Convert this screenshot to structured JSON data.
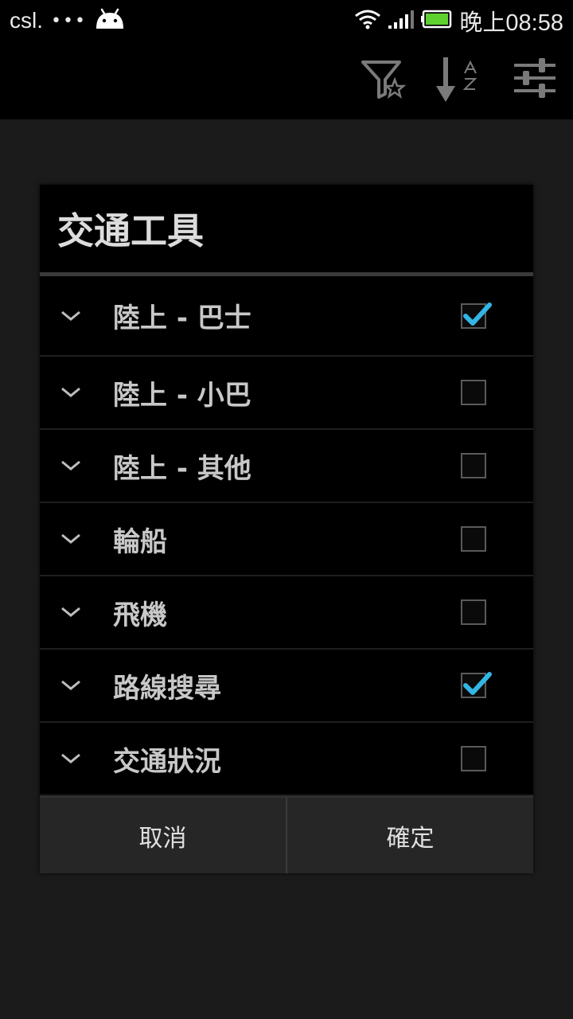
{
  "status_bar": {
    "carrier": "csl.",
    "dots": "•••",
    "time": "晚上08:58",
    "battery_color": "#5fd12f"
  },
  "action_bar": {
    "icons": [
      "filter-star-icon",
      "sort-az-icon",
      "settings-sliders-icon"
    ]
  },
  "dialog": {
    "title": "交通工具",
    "items": [
      {
        "label": "陸上 - 巴士",
        "checked": true
      },
      {
        "label": "陸上 - 小巴",
        "checked": false
      },
      {
        "label": "陸上 - 其他",
        "checked": false
      },
      {
        "label": "輪船",
        "checked": false
      },
      {
        "label": "飛機",
        "checked": false
      },
      {
        "label": "路線搜尋",
        "checked": true
      },
      {
        "label": "交通狀況",
        "checked": false
      }
    ],
    "cancel_label": "取消",
    "confirm_label": "確定",
    "check_color": "#33b5e5"
  }
}
